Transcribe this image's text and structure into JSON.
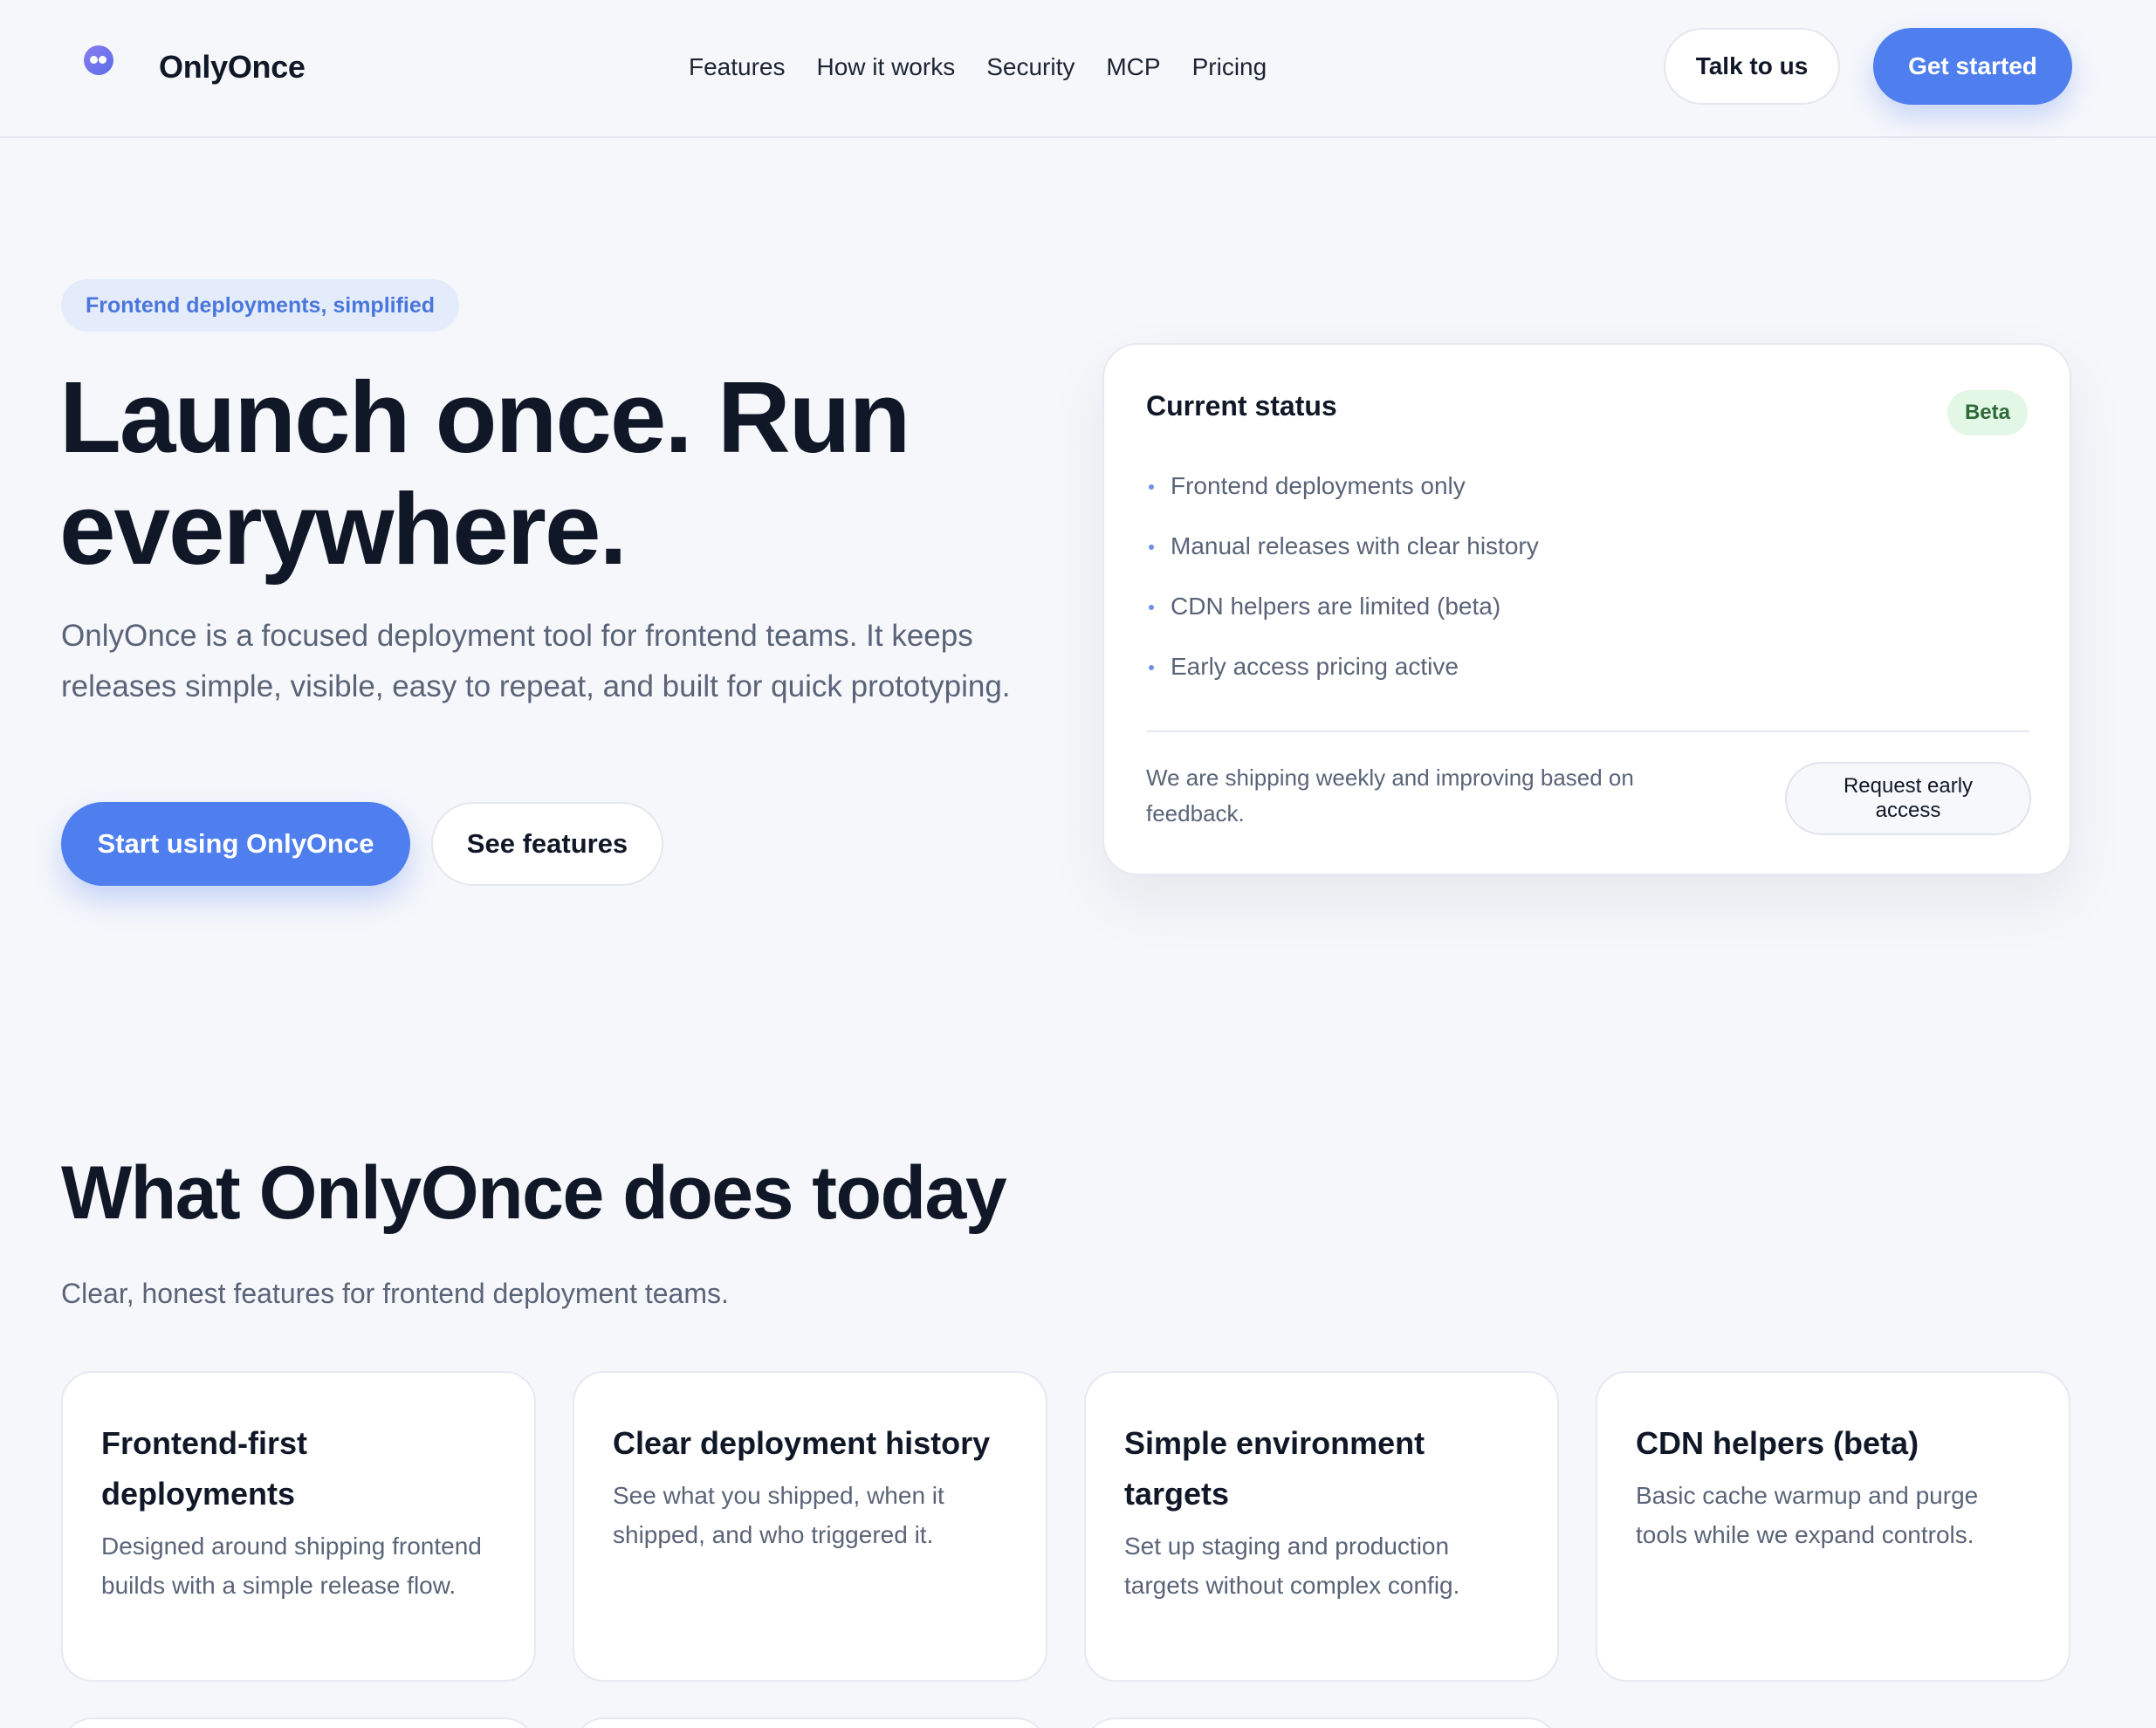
{
  "header": {
    "brand": "OnlyOnce",
    "nav": [
      "Features",
      "How it works",
      "Security",
      "MCP",
      "Pricing"
    ],
    "talk_label": "Talk to us",
    "get_started_label": "Get started"
  },
  "hero": {
    "pill": "Frontend deployments, simplified",
    "title": "Launch once. Run everywhere.",
    "subtitle": "OnlyOnce is a focused deployment tool for frontend teams. It keeps releases simple, visible, easy to repeat, and built for quick prototyping.",
    "primary_cta": "Start using OnlyOnce",
    "secondary_cta": "See features"
  },
  "status": {
    "title": "Current status",
    "badge": "Beta",
    "items": [
      "Frontend deployments only",
      "Manual releases with clear history",
      "CDN helpers are limited (beta)",
      "Early access pricing active"
    ],
    "note": "We are shipping weekly and improving based on feedback.",
    "request_label": "Request early access"
  },
  "features": {
    "title": "What OnlyOnce does today",
    "subtitle": "Clear, honest features for frontend deployment teams.",
    "cards": [
      {
        "title": "Frontend-first deployments",
        "body": "Designed around shipping frontend builds with a simple release flow."
      },
      {
        "title": "Clear deployment history",
        "body": "See what you shipped, when it shipped, and who triggered it."
      },
      {
        "title": "Simple environment targets",
        "body": "Set up staging and production targets without complex config."
      },
      {
        "title": "CDN helpers (beta)",
        "body": "Basic cache warmup and purge tools while we expand controls."
      }
    ]
  },
  "colors": {
    "accent": "#4f7fee",
    "background": "#f6f7fb",
    "beta_bg": "#e3f7e6",
    "beta_text": "#2c6a3a"
  },
  "icons": {
    "logo": "onlyonce-logo-icon"
  }
}
